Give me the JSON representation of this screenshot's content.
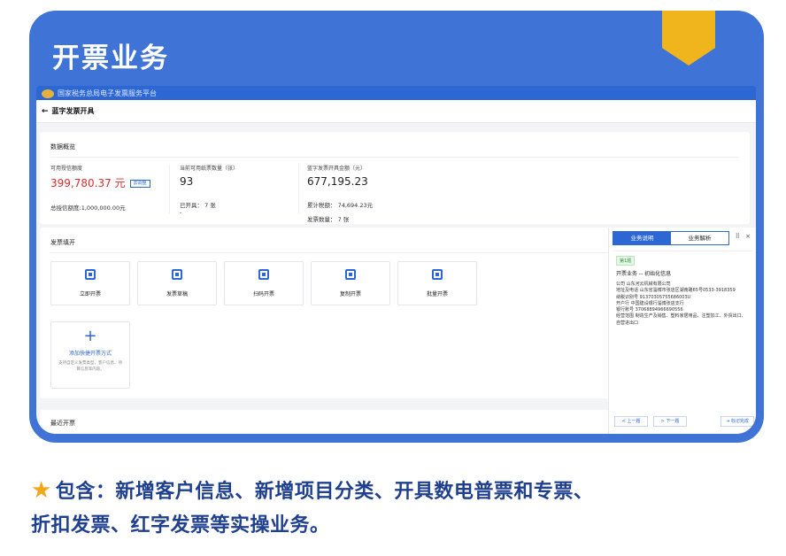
{
  "banner": {
    "title": "开票业务"
  },
  "app": {
    "system_name": "国家税务总局电子发票服务平台",
    "page_title": "蓝字发票开具"
  },
  "overview": {
    "section_title": "数据概览",
    "credit": {
      "label": "可用授信额度",
      "value": "399,780.37 元",
      "adjust_button": "去调整",
      "total": "总授信额度:1,000,000.00元"
    },
    "quantity": {
      "label": "当前可用纸票数量（张）",
      "value": "93",
      "issued": "已开具：  7 张",
      "dash": "-"
    },
    "amount": {
      "label": "蓝字发票开具金额（元）",
      "value": "677,195.23",
      "tax": "累计税额：  74,694.23元",
      "count": "发票数量：  7 张"
    }
  },
  "invoice_fill": {
    "section_title": "发票填开",
    "tiles": [
      {
        "label": "立即开票",
        "icon": "invoice-icon"
      },
      {
        "label": "发票草稿",
        "icon": "draft-icon"
      },
      {
        "label": "扫码开票",
        "icon": "qrcode-icon"
      },
      {
        "label": "复制开票",
        "icon": "copy-icon"
      },
      {
        "label": "批量开票",
        "icon": "batch-icon"
      }
    ],
    "add_shortcut": {
      "plus": "+",
      "title": "添加快捷开票方式",
      "desc": "支持自定义发票类型、客户信息、项目信息等内容。"
    }
  },
  "recent": {
    "section_title": "最近开票"
  },
  "panel": {
    "tabs": [
      "业务说明",
      "业务解析"
    ],
    "controls": "⠿ ×",
    "tag": "第1题",
    "subtitle": "开票业务 -- 初始化信息",
    "info_lines": [
      "公司  山东河云机械有限公司",
      "地址及电话  山东省淄博市张店区湖南路65号0533-3918359",
      "纳税识别号  91370305755686003U",
      "开户行  中国建设银行淄博张店支行",
      "银行账号  37068894966690556",
      "经营范围  制造生产及销售、塑料家居用品、注塑加工、外贸出口、",
      "自营进出口"
    ],
    "buttons": [
      "< 上一题",
      "> 下一题",
      "⇥ 标记完成"
    ]
  },
  "caption": {
    "star": "★",
    "line1": "包含：新增客户信息、新增项目分类、开具数电普票和专票、",
    "line2": "折扣发票、红字发票等实操业务。"
  }
}
